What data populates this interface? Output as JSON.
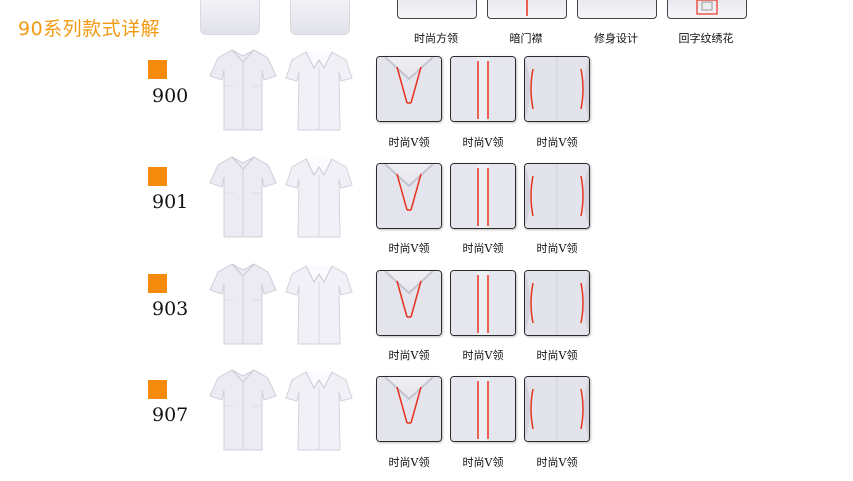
{
  "page": {
    "title": "90系列款式详解"
  },
  "top": {
    "labels": [
      "时尚方领",
      "暗门襟",
      "修身设计",
      "回字纹绣花"
    ]
  },
  "models": [
    {
      "code": "900",
      "captions": [
        "时尚V领",
        "时尚V领",
        "时尚V领"
      ]
    },
    {
      "code": "901",
      "captions": [
        "时尚V领",
        "时尚V领",
        "时尚V领"
      ]
    },
    {
      "code": "903",
      "captions": [
        "时尚V领",
        "时尚V领",
        "时尚V领"
      ]
    },
    {
      "code": "907",
      "captions": [
        "时尚V领",
        "时尚V领",
        "时尚V领"
      ]
    }
  ],
  "colors": {
    "title": "#f39a12",
    "marker": "#f58b0c",
    "accent_line": "#e8321e"
  }
}
